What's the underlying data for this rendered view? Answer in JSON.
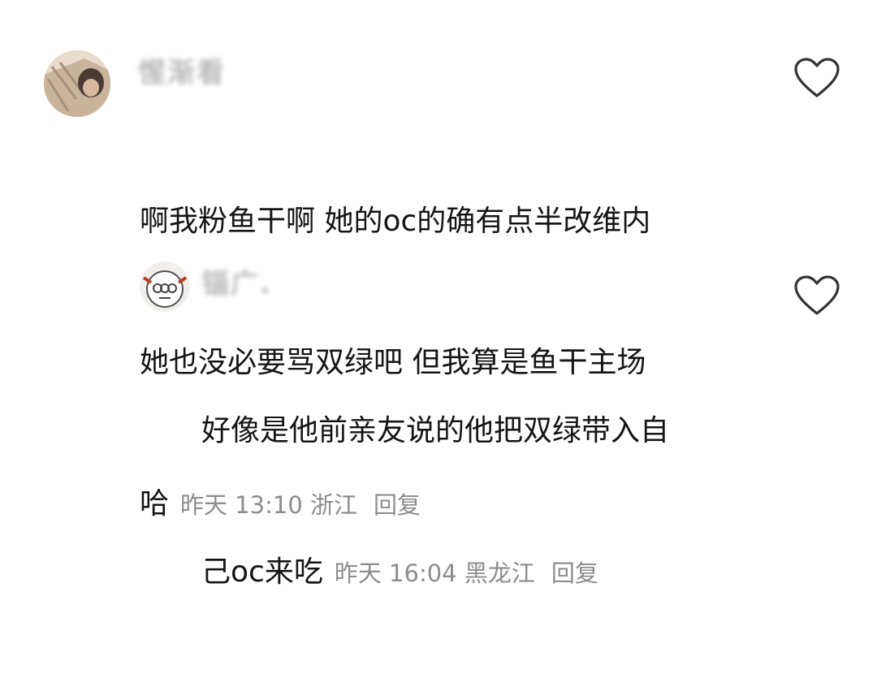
{
  "comments": [
    {
      "username": "惺渐看",
      "lines": [
        "啊我粉鱼干啊 她的oc的确有点半改维内",
        "她也没必要骂双绿吧 但我算是鱼干主场",
        "哈"
      ],
      "time": "昨天 13:10",
      "location": "浙江",
      "reply_label": "回复",
      "like_icon": "heart-outline-icon"
    },
    {
      "username": "锱广.",
      "lines": [
        "好像是他前亲友说的他把双绿带入自",
        "己oc来吃"
      ],
      "time": "昨天 16:04",
      "location": "黑龙江",
      "reply_label": "回复",
      "like_icon": "heart-outline-icon"
    }
  ]
}
